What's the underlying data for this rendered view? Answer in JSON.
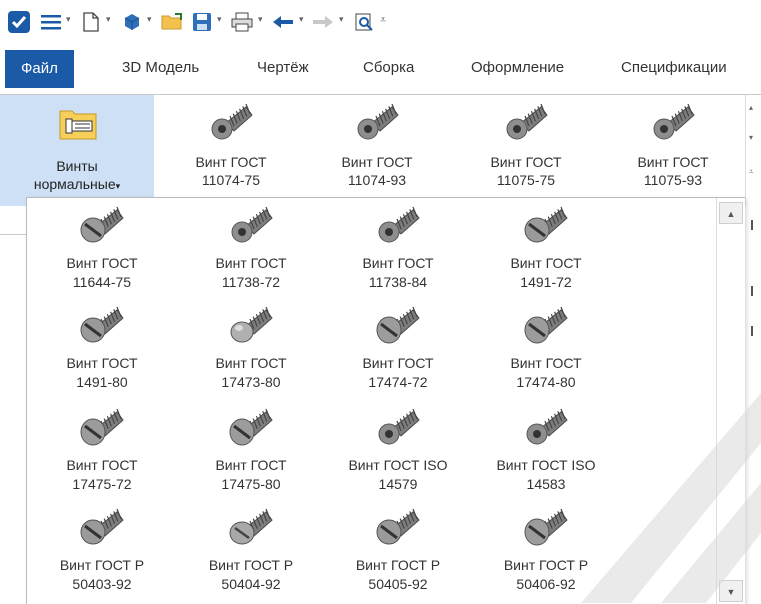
{
  "quick_access": {
    "icons": [
      "app-logo-icon",
      "menu-icon",
      "new-file-icon",
      "3d-cube-icon",
      "open-folder-icon",
      "save-icon",
      "print-icon",
      "undo-icon",
      "redo-icon",
      "zoom-icon",
      "customize-icon"
    ]
  },
  "tabs": [
    {
      "label": "Файл",
      "active": true
    },
    {
      "label": "3D Модель",
      "active": false
    },
    {
      "label": "Чертёж",
      "active": false
    },
    {
      "label": "Сборка",
      "active": false
    },
    {
      "label": "Оформление",
      "active": false
    },
    {
      "label": "Спецификации",
      "active": false
    }
  ],
  "ribbon": {
    "selected_group": {
      "line1": "Винты",
      "line2": "нормальные",
      "arrow": "▾"
    },
    "items": [
      {
        "line1": "Винт ГОСТ",
        "line2": "11074-75"
      },
      {
        "line1": "Винт ГОСТ",
        "line2": "11074-93"
      },
      {
        "line1": "Винт ГОСТ",
        "line2": "11075-75"
      },
      {
        "line1": "Винт ГОСТ",
        "line2": "11075-93"
      }
    ]
  },
  "gallery": {
    "rows": [
      [
        {
          "line1": "Винт ГОСТ",
          "line2": "11644-75",
          "head": "cheese"
        },
        {
          "line1": "Винт ГОСТ",
          "line2": "11738-72",
          "head": "socket"
        },
        {
          "line1": "Винт ГОСТ",
          "line2": "11738-84",
          "head": "socket"
        },
        {
          "line1": "Винт ГОСТ",
          "line2": "1491-72",
          "head": "cheese"
        }
      ],
      [
        {
          "line1": "Винт ГОСТ",
          "line2": "1491-80",
          "head": "cheese"
        },
        {
          "line1": "Винт ГОСТ",
          "line2": "17473-80",
          "head": "dome"
        },
        {
          "line1": "Винт ГОСТ",
          "line2": "17474-72",
          "head": "countersunk"
        },
        {
          "line1": "Винт ГОСТ",
          "line2": "17474-80",
          "head": "countersunk"
        }
      ],
      [
        {
          "line1": "Винт ГОСТ",
          "line2": "17475-72",
          "head": "countersunk"
        },
        {
          "line1": "Винт ГОСТ",
          "line2": "17475-80",
          "head": "countersunk"
        },
        {
          "line1": "Винт ГОСТ ISO",
          "line2": "14579",
          "head": "socket"
        },
        {
          "line1": "Винт ГОСТ ISO",
          "line2": "14583",
          "head": "socket"
        }
      ],
      [
        {
          "line1": "Винт ГОСТ Р",
          "line2": "50403-92",
          "head": "cheese"
        },
        {
          "line1": "Винт ГОСТ Р",
          "line2": "50404-92",
          "head": "pan"
        },
        {
          "line1": "Винт ГОСТ Р",
          "line2": "50405-92",
          "head": "cheese"
        },
        {
          "line1": "Винт ГОСТ Р",
          "line2": "50406-92",
          "head": "countersunk"
        }
      ]
    ]
  },
  "colors": {
    "accent": "#1b5aa6",
    "selected": "#cde0f6",
    "metal": "#8a8a8a"
  }
}
